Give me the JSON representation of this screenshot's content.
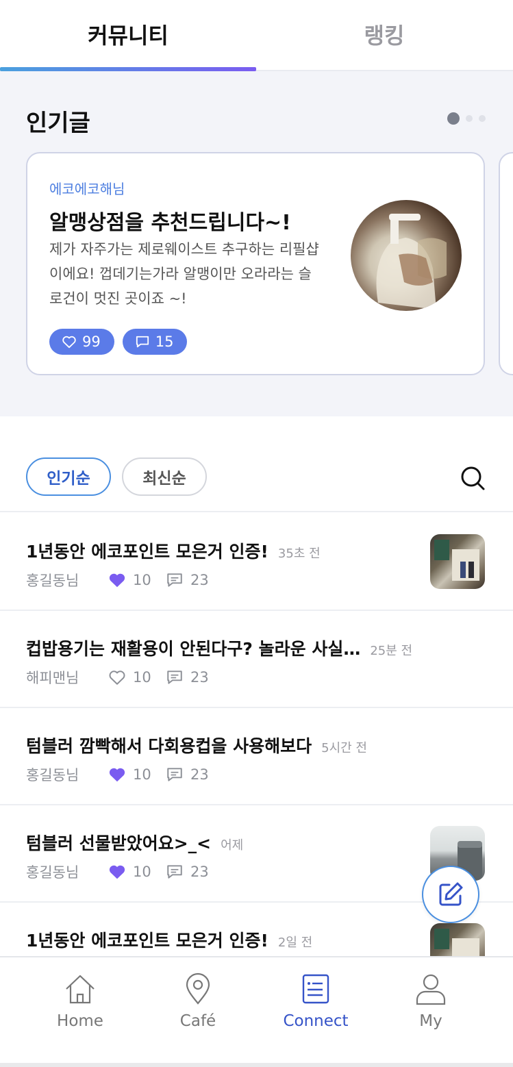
{
  "top_tabs": [
    {
      "label": "커뮤니티",
      "active": true
    },
    {
      "label": "랭킹",
      "active": false
    }
  ],
  "popular": {
    "title": "인기글",
    "card": {
      "author": "에코에코해님",
      "title": "알맹상점을 추천드립니다~!",
      "body": "제가 자주가는 제로웨이스트 추구하는 리필샵이에요! 껍데기는가라 알맹이만 오라라는 슬로건이 멋진 곳이죠 ~!",
      "likes": "99",
      "comments": "15"
    }
  },
  "filters": {
    "popular_label": "인기순",
    "latest_label": "최신순"
  },
  "posts": [
    {
      "title": "1년동안 에코포인트 모은거 인증!",
      "time": "35초 전",
      "author": "홍길동님",
      "likes": "10",
      "comments": "23",
      "liked": true
    },
    {
      "title": "컵밥용기는 재활용이 안된다구? 놀라운 사실…",
      "time": "25분 전",
      "author": "해피맨님",
      "likes": "10",
      "comments": "23",
      "liked": false
    },
    {
      "title": "텀블러 깜빡해서 다회용컵을 사용해보다",
      "time": "5시간 전",
      "author": "홍길동님",
      "likes": "10",
      "comments": "23",
      "liked": true
    },
    {
      "title": "텀블러 선물받았어요>_<",
      "time": "어제",
      "author": "홍길동님",
      "likes": "10",
      "comments": "23",
      "liked": true
    },
    {
      "title": "1년동안 에코포인트 모은거 인증!",
      "time": "2일 전",
      "author": "",
      "likes": "",
      "comments": "",
      "liked": true
    }
  ],
  "bottom_nav": [
    {
      "label": "Home",
      "icon": "home-icon",
      "active": false
    },
    {
      "label": "Café",
      "icon": "location-pin-icon",
      "active": false
    },
    {
      "label": "Connect",
      "icon": "list-icon",
      "active": true
    },
    {
      "label": "My",
      "icon": "user-icon",
      "active": false
    }
  ],
  "colors": {
    "accent": "#3553c8",
    "like": "#7a5cf0",
    "pill": "#5b7be8"
  }
}
